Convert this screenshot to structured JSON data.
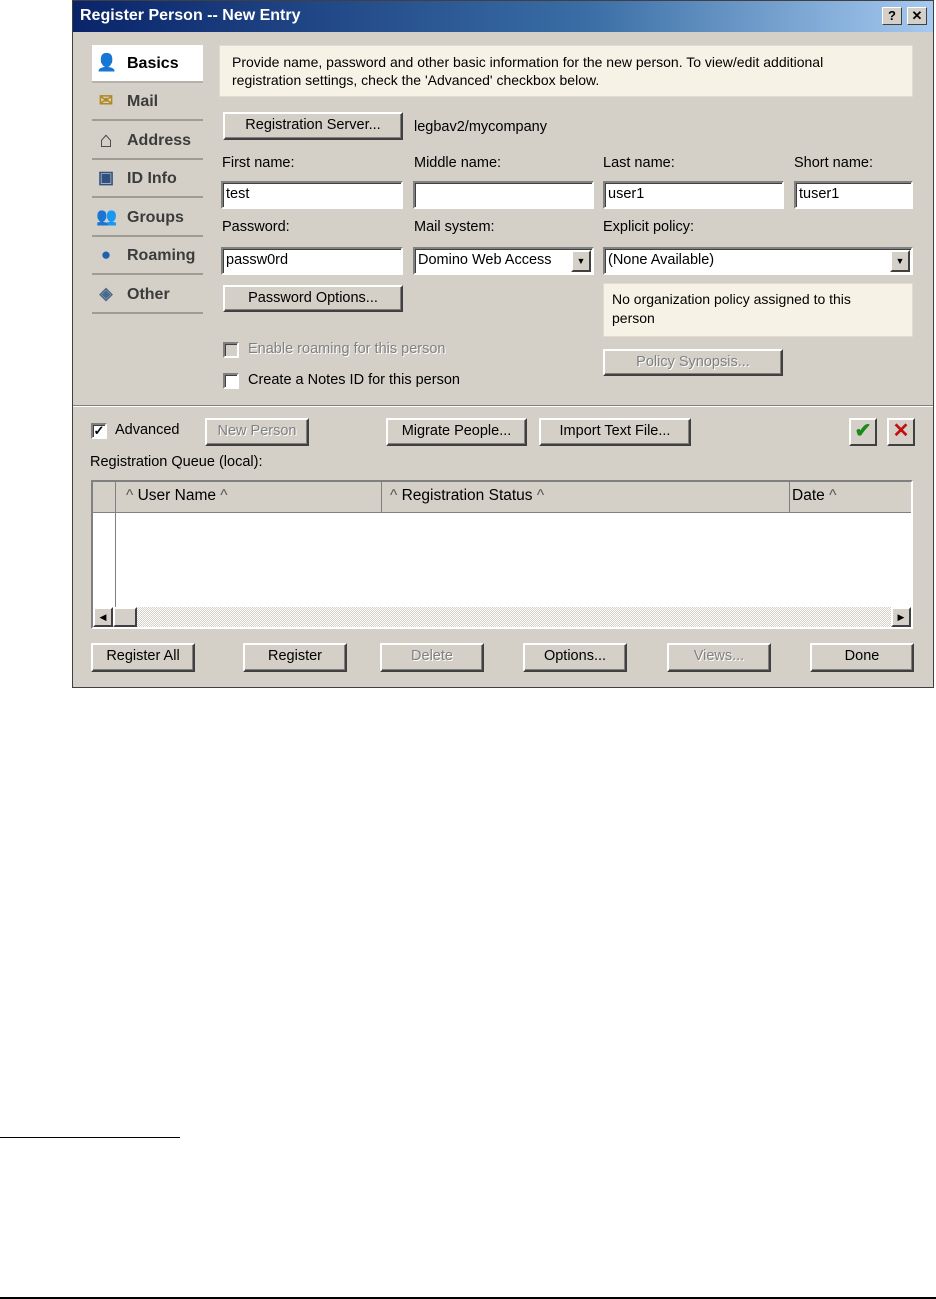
{
  "window": {
    "title": "Register Person -- New Entry",
    "help_glyph": "?",
    "close_glyph": "✕"
  },
  "nav": {
    "items": [
      {
        "label": "Basics",
        "icon": "basics-icon",
        "glyph": "👤",
        "active": true
      },
      {
        "label": "Mail",
        "icon": "mail-icon",
        "glyph": "✉"
      },
      {
        "label": "Address",
        "icon": "house-icon",
        "glyph": "⌂"
      },
      {
        "label": "ID Info",
        "icon": "id-card-icon",
        "glyph": "▣"
      },
      {
        "label": "Groups",
        "icon": "groups-icon",
        "glyph": "👥"
      },
      {
        "label": "Roaming",
        "icon": "globe-icon",
        "glyph": "●"
      },
      {
        "label": "Other",
        "icon": "other-icon",
        "glyph": "◈"
      }
    ]
  },
  "info": {
    "line1": "Provide name, password and other basic information for the new person.  To view/edit additional",
    "line2": "registration settings, check the 'Advanced' checkbox below."
  },
  "registration_server": {
    "button_label": "Registration Server...",
    "value": "legbav2/mycompany"
  },
  "fields": {
    "first_name_label": "First name:",
    "first_name_value": "test",
    "middle_name_label": "Middle name:",
    "middle_name_value": "",
    "last_name_label": "Last name:",
    "last_name_value": "user1",
    "short_name_label": "Short name:",
    "short_name_value": "tuser1",
    "password_label": "Password:",
    "password_value": "passw0rd",
    "mail_system_label": "Mail system:",
    "mail_system_value": "Domino Web Access",
    "explicit_policy_label": "Explicit policy:",
    "explicit_policy_value": "(None Available)"
  },
  "password_options_label": "Password Options...",
  "policy_note": {
    "line1": "No organization policy assigned to this",
    "line2": "person"
  },
  "policy_synopsis_label": "Policy Synopsis...",
  "checkboxes": {
    "enable_roaming": {
      "label": "Enable roaming for this person",
      "checked": false,
      "enabled": false
    },
    "create_notes_id": {
      "label": "Create a Notes ID for this person",
      "checked": false,
      "enabled": true
    },
    "advanced": {
      "label": "Advanced",
      "checked": true,
      "check_glyph": "✓"
    }
  },
  "actions": {
    "new_person": "New Person",
    "migrate_people": "Migrate People...",
    "import_text_file": "Import Text File...",
    "accept_glyph": "✔",
    "reject_glyph": "✕"
  },
  "queue": {
    "label": "Registration Queue (local):",
    "columns": [
      "User Name",
      "Registration Status",
      "Date"
    ],
    "sort_glyph": "^",
    "rows": []
  },
  "footer_buttons": {
    "register_all": "Register All",
    "register": "Register",
    "delete": "Delete",
    "options": "Options...",
    "views": "Views...",
    "done": "Done"
  },
  "colors": {
    "dialog_bg": "#d4d0c8",
    "title_gradient_start": "#0a246a",
    "info_bg": "#f7f2e6",
    "accept_green": "#1a8a1a",
    "reject_red": "#c01010"
  }
}
